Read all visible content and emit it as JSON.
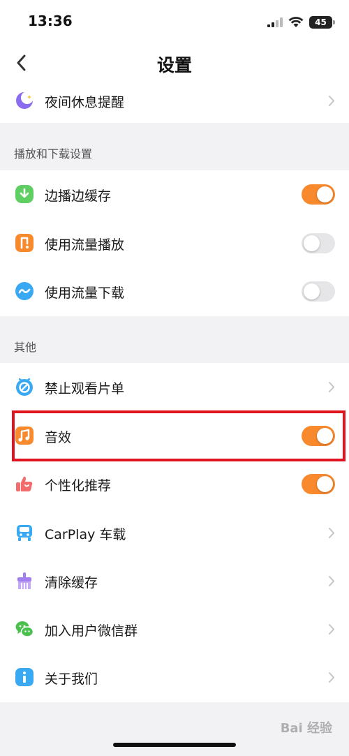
{
  "status_bar": {
    "time": "13:36",
    "battery": "45"
  },
  "nav": {
    "title": "设置"
  },
  "top_group": {
    "items": [
      {
        "label": "夜间休息提醒",
        "icon": "moon-icon",
        "control": "chevron"
      }
    ]
  },
  "playback_group": {
    "header": "播放和下载设置",
    "items": [
      {
        "label": "边播边缓存",
        "icon": "download-cache-icon",
        "control": "toggle",
        "on": true
      },
      {
        "label": "使用流量播放",
        "icon": "data-play-icon",
        "control": "toggle",
        "on": false
      },
      {
        "label": "使用流量下载",
        "icon": "data-download-icon",
        "control": "toggle",
        "on": false
      }
    ]
  },
  "other_group": {
    "header": "其他",
    "items": [
      {
        "label": "禁止观看片单",
        "icon": "block-icon",
        "control": "chevron"
      },
      {
        "label": "音效",
        "icon": "music-note-icon",
        "control": "toggle",
        "on": true
      },
      {
        "label": "个性化推荐",
        "icon": "thumbs-up-icon",
        "control": "toggle",
        "on": true
      },
      {
        "label": "CarPlay 车载",
        "icon": "car-icon",
        "control": "chevron"
      },
      {
        "label": "清除缓存",
        "icon": "broom-icon",
        "control": "chevron"
      },
      {
        "label": "加入用户微信群",
        "icon": "wechat-icon",
        "control": "chevron"
      },
      {
        "label": "关于我们",
        "icon": "info-icon",
        "control": "chevron"
      }
    ]
  },
  "watermark": "Bai 经验",
  "colors": {
    "accent": "#f8892d",
    "toggle_off": "#e6e6e8",
    "highlight": "#e0141e"
  }
}
